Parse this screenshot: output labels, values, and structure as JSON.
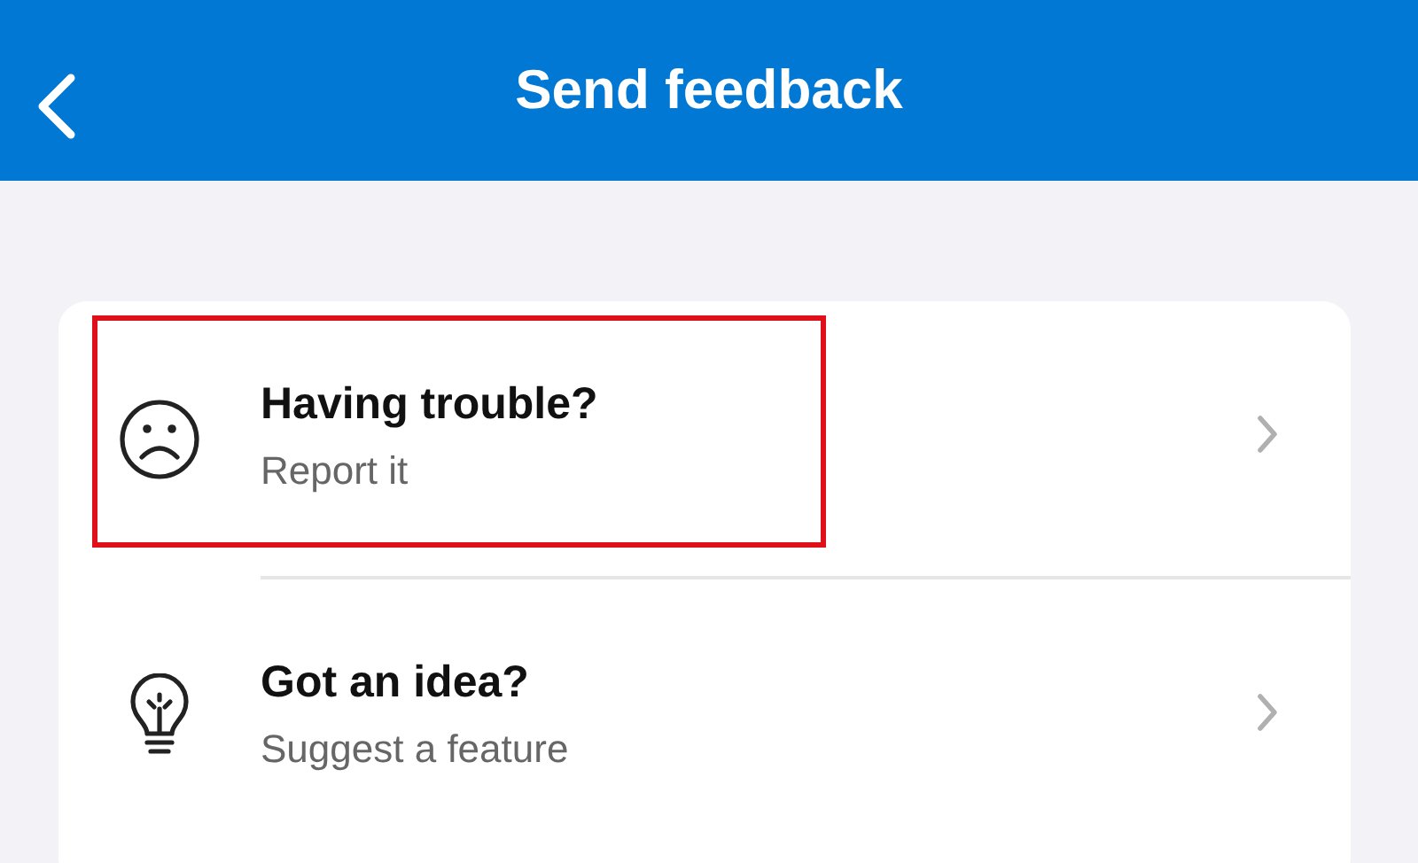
{
  "header": {
    "title": "Send feedback"
  },
  "items": [
    {
      "kind": "sad-face",
      "title": "Having trouble?",
      "subtitle": "Report it",
      "highlighted": true
    },
    {
      "kind": "lightbulb",
      "title": "Got an idea?",
      "subtitle": "Suggest a feature",
      "highlighted": false
    }
  ]
}
